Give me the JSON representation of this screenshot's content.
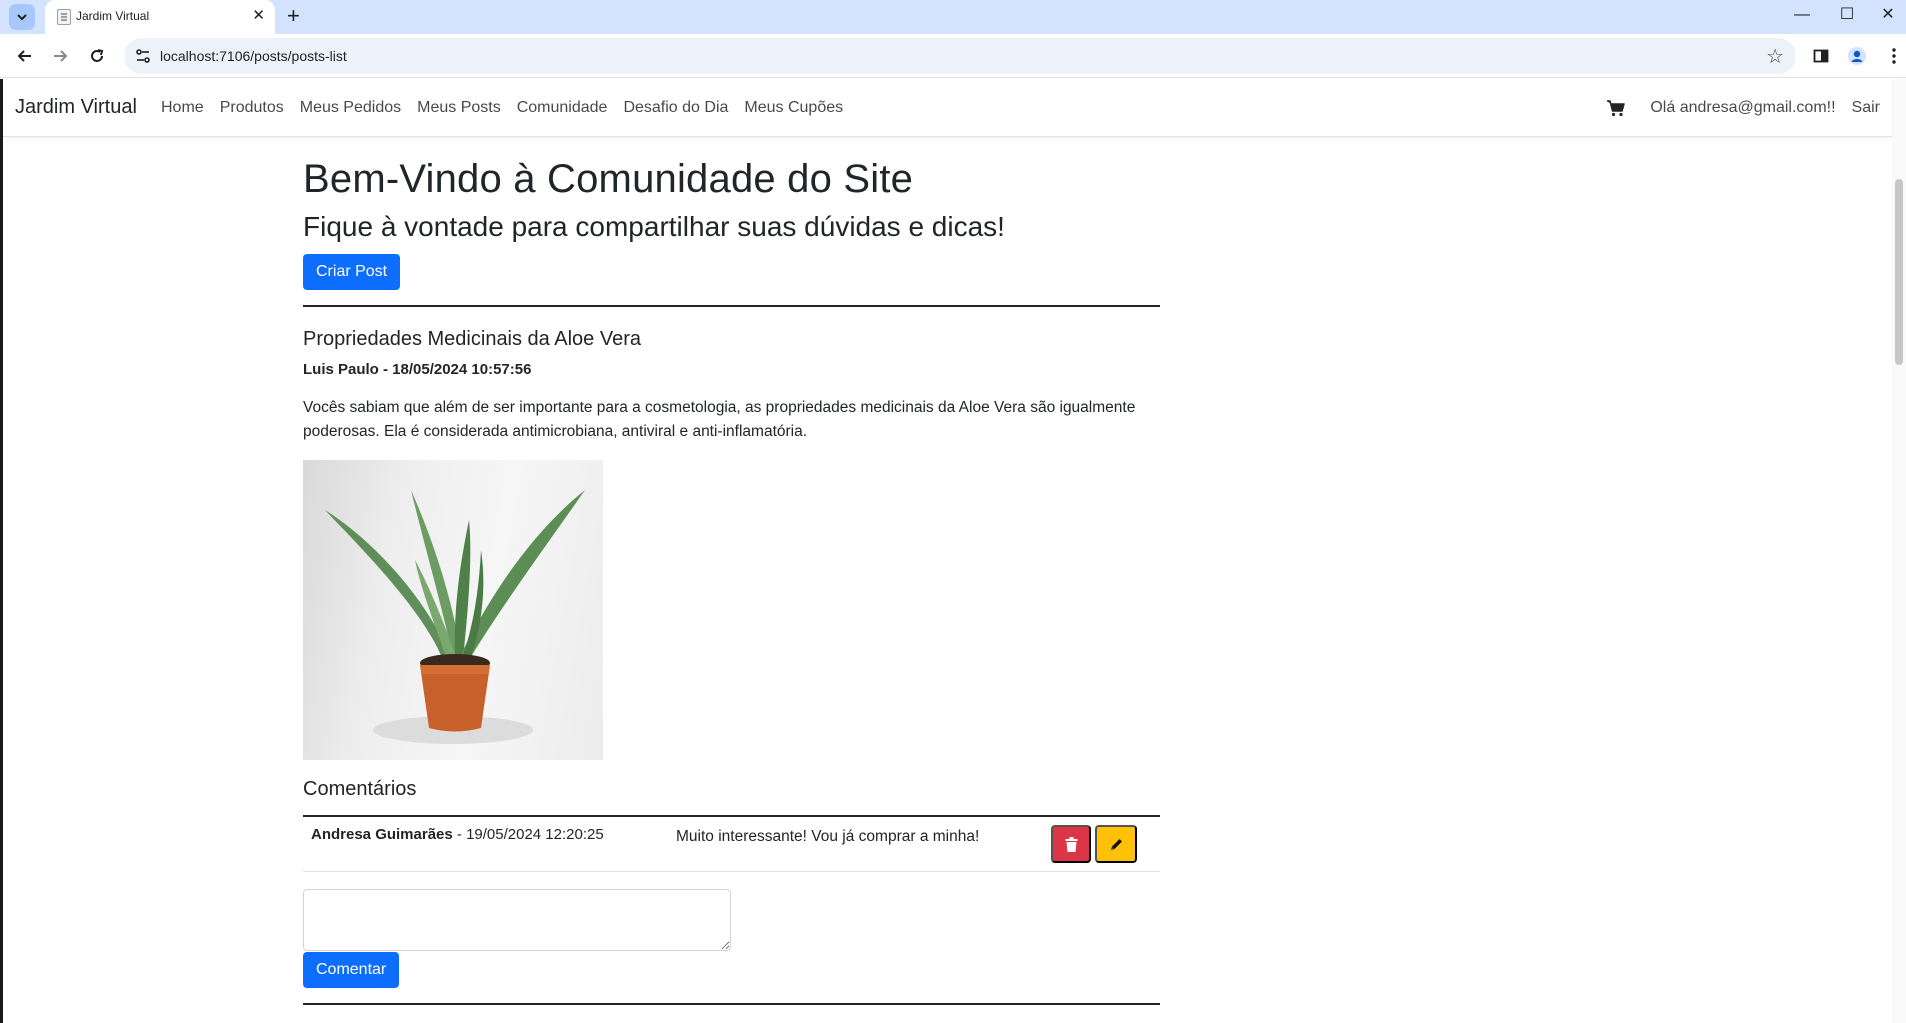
{
  "browser": {
    "tab_title": "Jardim Virtual",
    "url": "localhost:7106/posts/posts-list"
  },
  "navbar": {
    "brand": "Jardim Virtual",
    "links": [
      "Home",
      "Produtos",
      "Meus Pedidos",
      "Meus Posts",
      "Comunidade",
      "Desafio do Dia",
      "Meus Cupões"
    ],
    "greeting": "Olá andresa@gmail.com!!",
    "logout": "Sair"
  },
  "main": {
    "heading": "Bem-Vindo à Comunidade do Site",
    "subheading": "Fique à vontade para compartilhar suas dúvidas e dicas!",
    "create_post_label": "Criar Post"
  },
  "post": {
    "title": "Propriedades Medicinais da Aloe Vera",
    "meta": "Luis Paulo - 18/05/2024 10:57:56",
    "body": "Vocês sabiam que além de ser importante para a cosmetologia, as propriedades medicinais da Aloe Vera são igualmente poderosas. Ela é considerada antimicrobiana, antiviral e anti-inflamatória.",
    "image_alt": "aloe-vera-plant-photo",
    "comments_heading": "Comentários",
    "comments": [
      {
        "author": "Andresa Guimarães",
        "date": " - 19/05/2024 12:20:25",
        "text": "Muito interessante! Vou já comprar a minha!"
      }
    ],
    "comment_placeholder": "",
    "comment_button": "Comentar"
  },
  "colors": {
    "primary": "#0d6efd",
    "danger": "#dc3545",
    "warning": "#ffc107",
    "chrome_tabbar": "#d3e3fd"
  },
  "icons": {
    "cart": "cart-icon",
    "delete": "trash-icon",
    "edit": "pencil-icon"
  }
}
